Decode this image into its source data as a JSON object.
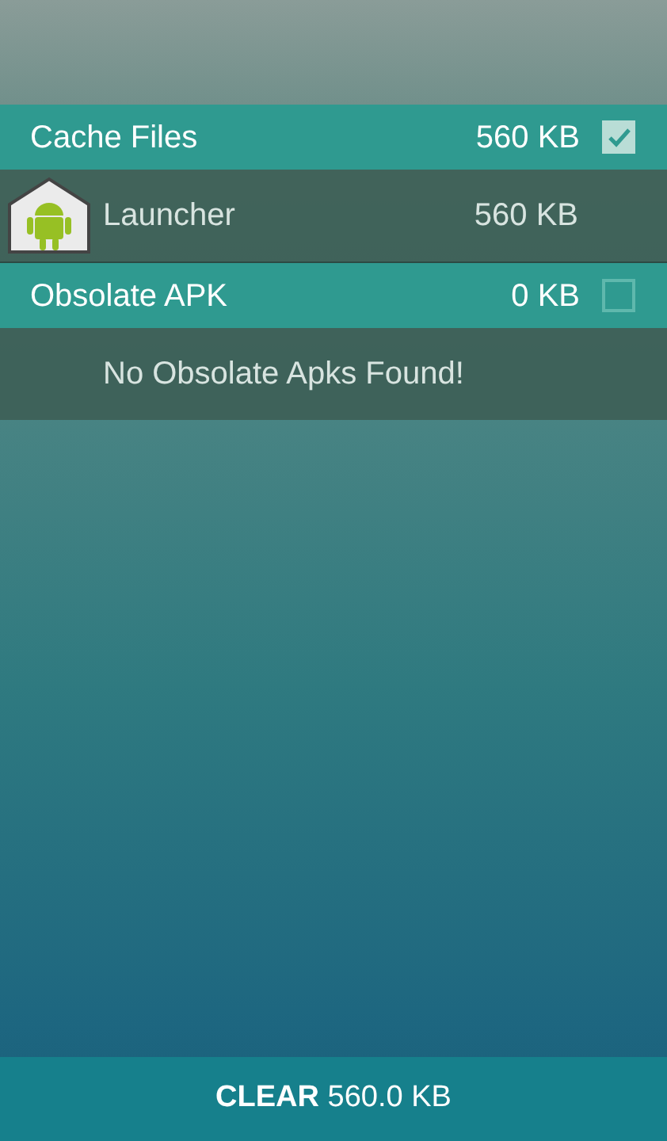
{
  "sections": [
    {
      "title": "Cache Files",
      "size": "560 KB",
      "checked": true,
      "items": [
        {
          "name": "Launcher",
          "size": "560 KB"
        }
      ]
    },
    {
      "title": "Obsolate APK",
      "size": "0 KB",
      "checked": false,
      "empty_message": "No Obsolate Apks Found!"
    }
  ],
  "clear_button": {
    "label": "**CLEAR** 560.0 KB"
  }
}
